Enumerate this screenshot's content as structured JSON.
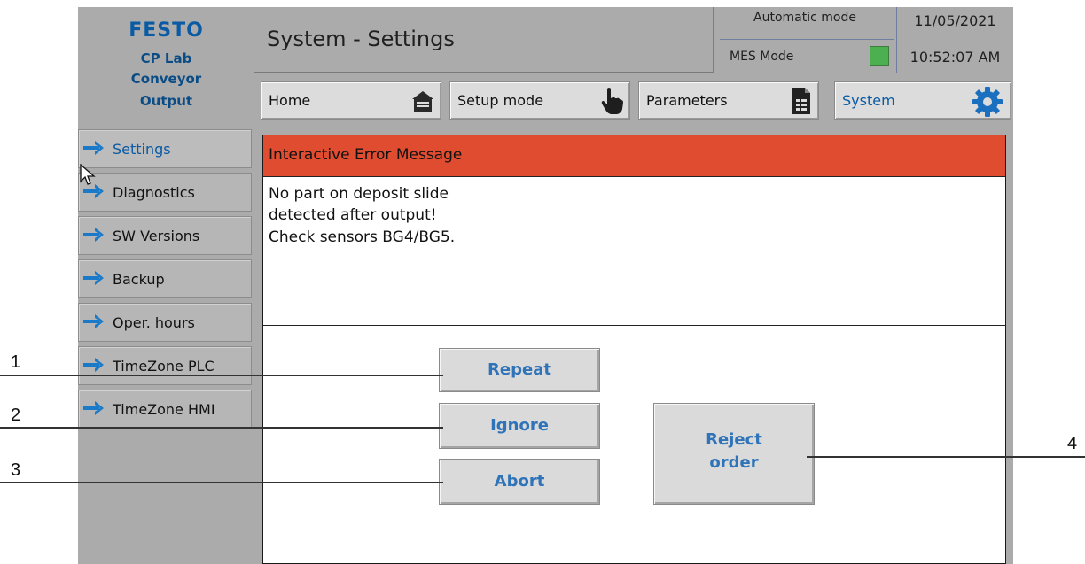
{
  "brand": {
    "logo": "FESTO",
    "station": [
      "CP Lab",
      "Conveyor",
      "Output"
    ]
  },
  "header": {
    "title": "System - Settings",
    "mode_auto": "Automatic mode",
    "mode_mes": "MES Mode",
    "mes_led_color": "#4caf50",
    "date": "11/05/2021",
    "time": "10:52:07 AM"
  },
  "nav": {
    "home": "Home",
    "setup": "Setup mode",
    "parameters": "Parameters",
    "system": "System"
  },
  "sidebar": {
    "items": [
      {
        "label": "Settings"
      },
      {
        "label": "Diagnostics"
      },
      {
        "label": "SW Versions"
      },
      {
        "label": "Backup"
      },
      {
        "label": "Oper. hours"
      },
      {
        "label": "TimeZone PLC"
      },
      {
        "label": "TimeZone HMI"
      }
    ],
    "arrow_icon": "arrow-right-icon",
    "arrow_color": "#1a7ac8"
  },
  "error": {
    "title": "Interactive Error Message",
    "header_color": "#df4c30",
    "lines": [
      "No part on deposit slide",
      "detected after output!",
      "Check sensors BG4/BG5."
    ]
  },
  "actions": {
    "repeat": "Repeat",
    "ignore": "Ignore",
    "abort": "Abort",
    "reject": [
      "Reject",
      "order"
    ]
  },
  "callouts": [
    "1",
    "2",
    "3",
    "4"
  ]
}
